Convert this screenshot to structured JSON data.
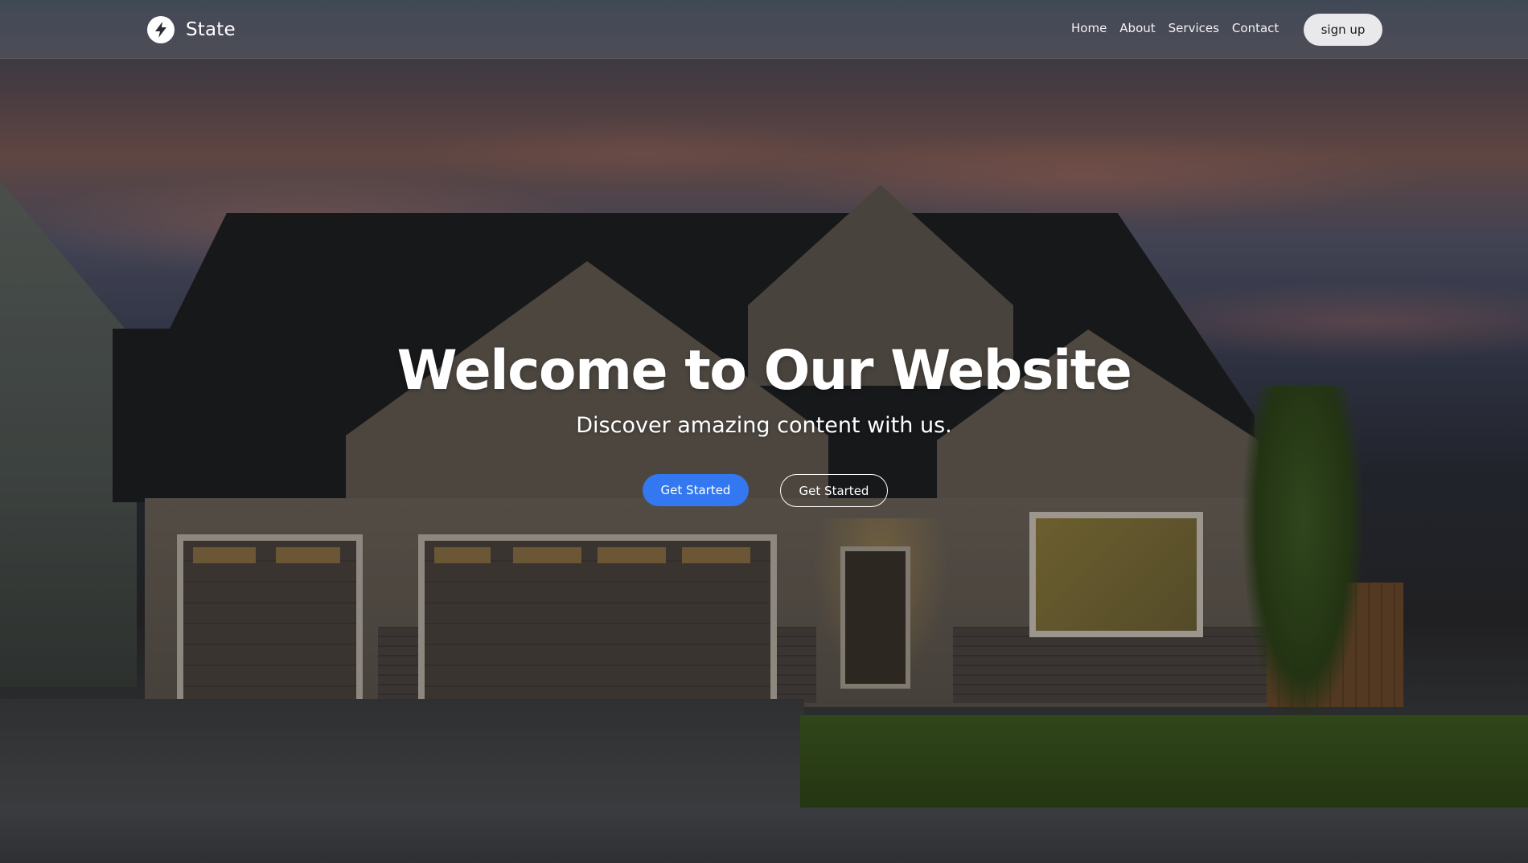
{
  "navbar": {
    "brand_name": "State",
    "links": [
      "Home",
      "About",
      "Services",
      "Contact"
    ],
    "signup_label": "sign up"
  },
  "hero": {
    "title": "Welcome to Our Website",
    "subtitle": "Discover amazing content with us.",
    "primary_button_label": "Get Started",
    "secondary_button_label": "Get Started",
    "background_image": "house-at-dusk"
  },
  "colors": {
    "primary_button": "#3378f0",
    "signup_button": "#e9e9ec",
    "text": "#ffffff"
  },
  "icons": {
    "brand": "lightning-bolt-icon"
  }
}
